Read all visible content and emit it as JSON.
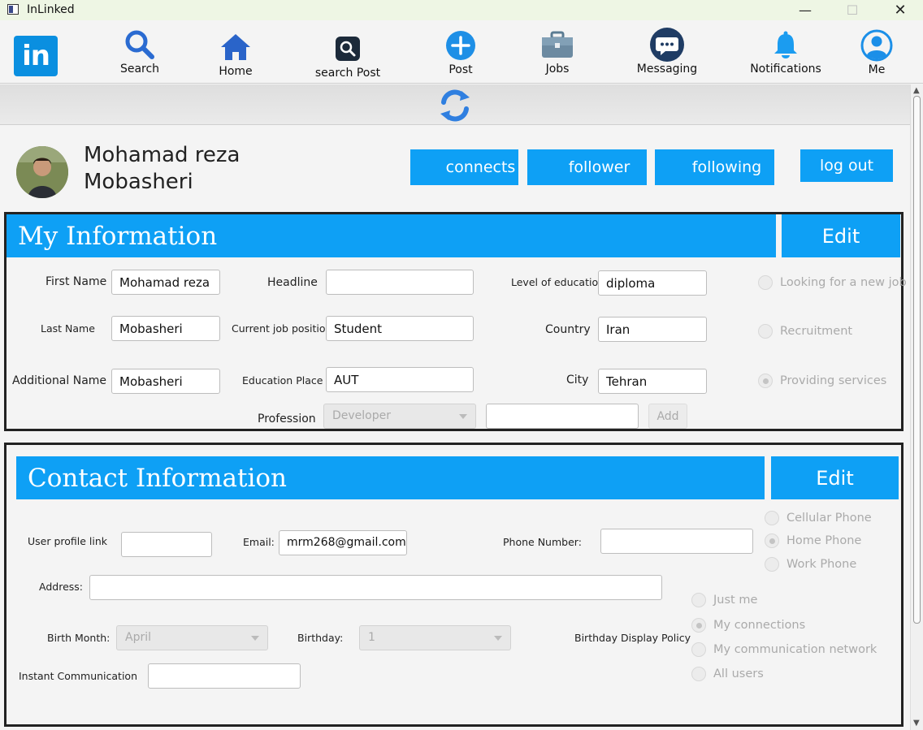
{
  "window": {
    "title": "InLinked"
  },
  "nav": {
    "logo_text": "in",
    "items": [
      {
        "label": "Search",
        "icon": "search-icon"
      },
      {
        "label": "Home",
        "icon": "home-icon"
      },
      {
        "label": "search Post",
        "icon": "search-post-icon"
      },
      {
        "label": "Post",
        "icon": "plus-circle-icon"
      },
      {
        "label": "Jobs",
        "icon": "briefcase-icon"
      },
      {
        "label": "Messaging",
        "icon": "chat-bubble-icon"
      },
      {
        "label": "Notifications",
        "icon": "bell-icon"
      },
      {
        "label": "Me",
        "icon": "user-icon"
      }
    ]
  },
  "profile": {
    "first_line": "Mohamad reza",
    "second_line": "Mobasheri",
    "buttons": {
      "connects": "connects",
      "follower": "follower",
      "following": "following",
      "logout": "log out"
    }
  },
  "my_information": {
    "title": "My Information",
    "edit": "Edit",
    "fields": {
      "first_name": {
        "label": "First Name",
        "value": "Mohamad reza"
      },
      "last_name": {
        "label": "Last Name",
        "value": "Mobasheri"
      },
      "additional_name": {
        "label": "Additional Name",
        "value": "Mobasheri"
      },
      "headline": {
        "label": "Headline",
        "value": ""
      },
      "current_job": {
        "label": "Current job position",
        "value": "Student"
      },
      "education_place": {
        "label": "Education Place",
        "value": "AUT"
      },
      "level_of_education": {
        "label": "Level of education",
        "value": "diploma"
      },
      "country": {
        "label": "Country",
        "value": "Iran"
      },
      "city": {
        "label": "City",
        "value": "Tehran"
      }
    },
    "profession": {
      "label": "Profession",
      "selected": "Developer",
      "input_value": "",
      "add_label": "Add"
    },
    "job_status": {
      "options": [
        "Looking for a new job",
        "Recruitment",
        "Providing services"
      ],
      "selected": "Providing services"
    }
  },
  "contact_information": {
    "title": "Contact Information",
    "edit": "Edit",
    "fields": {
      "profile_link": {
        "label": "User profile link",
        "value": ""
      },
      "email": {
        "label": "Email:",
        "value": "mrm268@gmail.com"
      },
      "phone": {
        "label": "Phone Number:",
        "value": ""
      },
      "address": {
        "label": "Address:",
        "value": ""
      },
      "instant": {
        "label": "Instant Communication",
        "value": ""
      }
    },
    "phone_type": {
      "options": [
        "Cellular Phone",
        "Home Phone",
        "Work Phone"
      ],
      "selected": "Home Phone"
    },
    "birth_month": {
      "label": "Birth Month:",
      "selected": "April"
    },
    "birthday": {
      "label": "Birthday:",
      "selected": "1"
    },
    "birthday_policy": {
      "label": "Birthday Display Policy",
      "options": [
        "Just me",
        "My connections",
        "My communication network",
        "All users"
      ],
      "selected": "My connections"
    }
  },
  "colors": {
    "accent": "#0ea0f5",
    "logo": "#0a8fe0"
  }
}
